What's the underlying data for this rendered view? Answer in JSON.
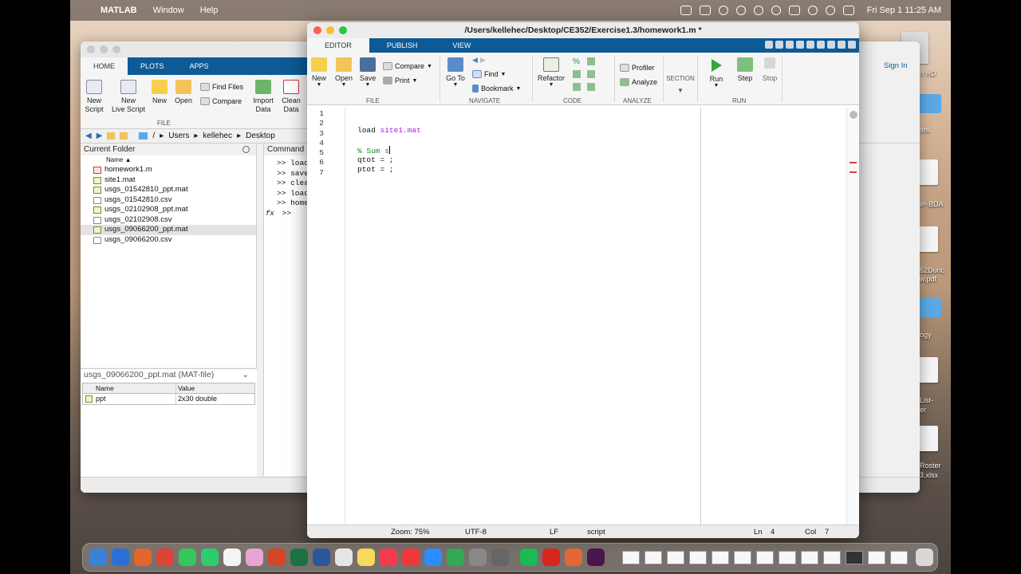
{
  "menubar": {
    "app_name": "MATLAB",
    "items": [
      "Window",
      "Help"
    ],
    "clock": "Fri Sep 1  11:25 AM"
  },
  "desktop": {
    "labels": [
      "h HD",
      "tes",
      "er-BDA",
      "62Dunc",
      "w.pdf",
      "ogy",
      "List-",
      "er",
      "Roster",
      "3.xlsx"
    ]
  },
  "main_window": {
    "tabs": [
      "HOME",
      "PLOTS",
      "APPS"
    ],
    "ribbon": {
      "new_script": "New\nScript",
      "new_live_script": "New\nLive Script",
      "new": "New",
      "open": "Open",
      "find_files": "Find Files",
      "compare": "Compare",
      "import_data": "Import\nData",
      "clean_data": "Clean\nData",
      "file_group": "FILE"
    },
    "sign_in": "Sign In",
    "address": [
      "/",
      "Users",
      "kellehec",
      "Desktop"
    ],
    "current_folder": {
      "title": "Current Folder",
      "name_header": "Name ▲",
      "files": [
        {
          "name": "homework1.m",
          "type": "m"
        },
        {
          "name": "site1.mat",
          "type": "mat"
        },
        {
          "name": "usgs_01542810_ppt.mat",
          "type": "mat"
        },
        {
          "name": "usgs_01542810.csv",
          "type": "csv"
        },
        {
          "name": "usgs_02102908_ppt.mat",
          "type": "mat"
        },
        {
          "name": "usgs_02102908.csv",
          "type": "csv"
        },
        {
          "name": "usgs_09066200_ppt.mat",
          "type": "mat"
        },
        {
          "name": "usgs_09066200.csv",
          "type": "csv"
        }
      ],
      "selected_index": 6
    },
    "details": {
      "title": "usgs_09066200_ppt.mat  (MAT-file)",
      "headers": [
        "Name",
        "Value"
      ],
      "rows": [
        {
          "name": "ppt",
          "value": "2x30 double"
        }
      ]
    },
    "command_window": {
      "title": "Command",
      "lines": [
        ">> load",
        ">> save",
        ">> clea",
        ">> load",
        ">> home"
      ],
      "prompt": ">>",
      "fx": "fx"
    }
  },
  "editor": {
    "title": "/Users/kellehec/Desktop/CE352/Exercise1.3/homework1.m *",
    "tabs": [
      "EDITOR",
      "PUBLISH",
      "VIEW"
    ],
    "ribbon": {
      "new": "New",
      "open": "Open",
      "save": "Save",
      "compare": "Compare",
      "print": "Print",
      "go_to": "Go To",
      "find": "Find",
      "bookmark": "Bookmark",
      "refactor": "Refactor",
      "profiler": "Profiler",
      "analyze": "Analyze",
      "section": "SECTION",
      "run": "Run",
      "step": "Step",
      "stop": "Stop",
      "groups": [
        "FILE",
        "NAVIGATE",
        "CODE",
        "ANALYZE",
        "RUN"
      ]
    },
    "line_numbers": [
      "1",
      "2",
      "3",
      "4",
      "5",
      "6",
      "7"
    ],
    "code": {
      "line2_cmd": "load ",
      "line2_arg": "site1.mat",
      "line4": "% Sum s",
      "line5": "qtot = ;",
      "line6": "ptot = ;"
    },
    "status": {
      "zoom": "Zoom: 75%",
      "encoding": "UTF-8",
      "eol": "LF",
      "mode": "script",
      "ln_label": "Ln",
      "ln": "4",
      "col_label": "Col",
      "col": "7"
    }
  },
  "colors": {
    "ribbon_blue": "#0d5a96",
    "string_purple": "#a020f0",
    "comment_green": "#228b22"
  }
}
